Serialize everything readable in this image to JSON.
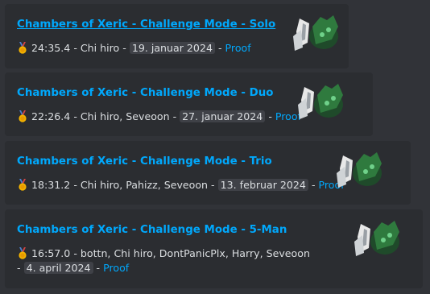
{
  "cards": [
    {
      "title": "Chambers of Xeric - Challenge Mode - Solo",
      "time": "24:35.4",
      "players": "Chi hiro",
      "date": "19. januar 2024",
      "proof": "Proof"
    },
    {
      "title": "Chambers of Xeric - Challenge Mode - Duo",
      "time": "22:26.4",
      "players": "Chi hiro, Seveoon",
      "date": "27. januar 2024",
      "proof": "Proof"
    },
    {
      "title": "Chambers of Xeric - Challenge Mode - Trio",
      "time": "18:31.2",
      "players": "Chi hiro, Pahizz, Seveoon",
      "date": "13. februar 2024",
      "proof": "Proof"
    },
    {
      "title": "Chambers of Xeric - Challenge Mode - 5-Man",
      "time": "16:57.0",
      "players": "bottn, Chi hiro, DontPanicPlx, Harry, Seveoon",
      "date": "4. april 2024",
      "proof": "Proof"
    }
  ],
  "separator": " - ",
  "icons": {
    "medal": "gold-medal-icon",
    "thumbnail": "olm-boss-thumbnail"
  },
  "colors": {
    "link": "#00a8fc",
    "card": "#2b2d31",
    "background": "#313338"
  }
}
